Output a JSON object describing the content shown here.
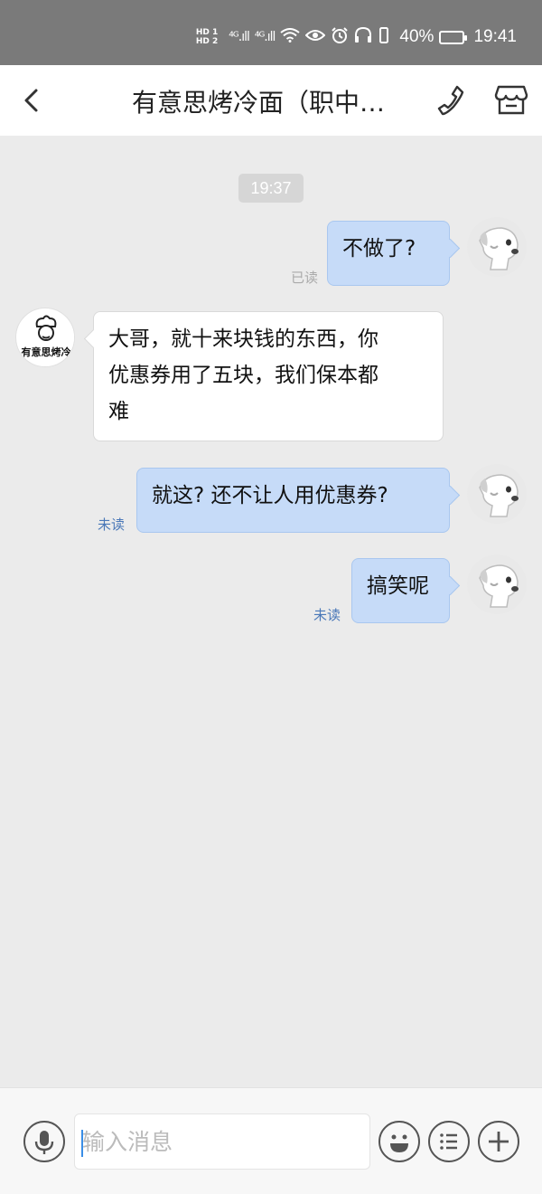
{
  "status_bar": {
    "hd1": "HD 1",
    "hd2": "HD 2",
    "signal1": "⁴ᴳ.ıll",
    "signal2": "⁴ᴳ.ıll",
    "wifi": "⁶",
    "battery_percent": "40%",
    "time": "19:41",
    "icons": [
      "eye-icon",
      "alarm-icon",
      "headphones-icon",
      "battery-icon",
      "charging-icon"
    ]
  },
  "header": {
    "title": "有意思烤冷面（职中…",
    "icons": [
      "back-arrow-icon",
      "phone-icon",
      "shop-icon"
    ]
  },
  "chat": {
    "timestamp": "19:37",
    "messages": [
      {
        "side": "me",
        "text": "不做了?",
        "status": "已读"
      },
      {
        "side": "them",
        "lines": [
          "大哥，就十来块钱的东西，你",
          "优惠券用了五块，我们保本都",
          "难"
        ]
      },
      {
        "side": "me",
        "text": "就这? 还不让人用优惠券?",
        "status": "未读"
      },
      {
        "side": "me",
        "text": "搞笑呢",
        "status": "未读"
      }
    ],
    "shop_avatar_text": "有意思烤冷"
  },
  "input_bar": {
    "placeholder": "输入消息",
    "icons": [
      "microphone-icon",
      "emoji-icon",
      "list-icon",
      "plus-icon"
    ]
  },
  "colors": {
    "statusbar_bg": "#7a7a7a",
    "chat_bg": "#ebebeb",
    "my_bubble": "#c6dbf8",
    "their_bubble": "#ffffff",
    "unread_text": "#4a78b8",
    "read_text": "#aaaaaa"
  }
}
